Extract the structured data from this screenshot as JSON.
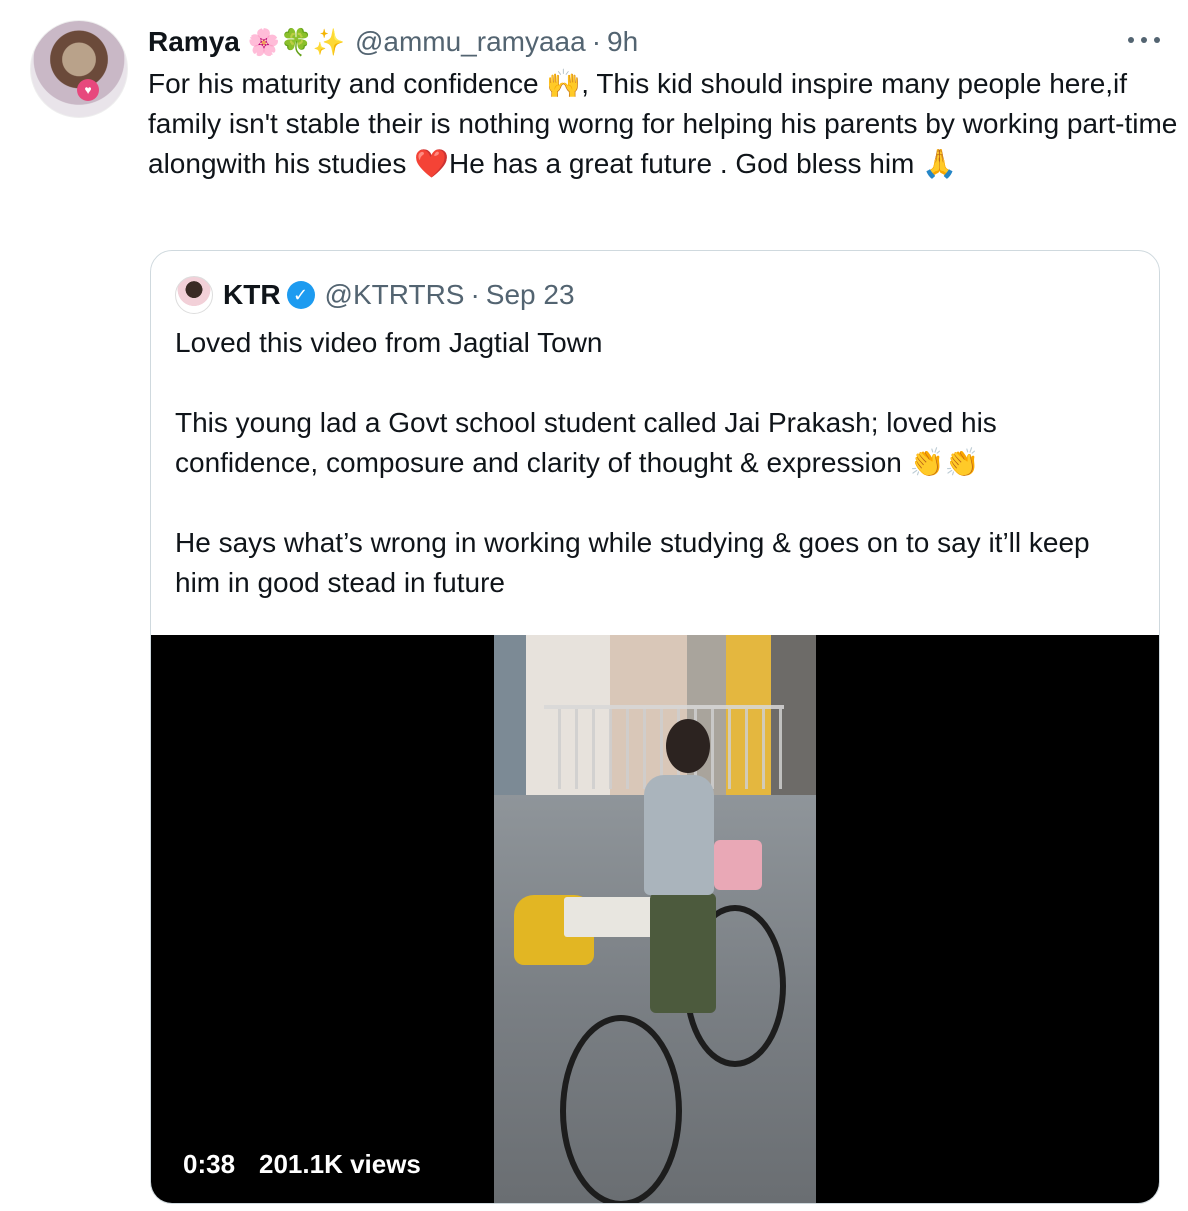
{
  "tweet": {
    "name": "Ramya",
    "name_emojis": "🌸🍀✨",
    "handle": "@ammu_ramyaaa",
    "separator": "·",
    "time": "9h",
    "text": "For his maturity and confidence 🙌, This kid should inspire many people here,if family isn't stable their is nothing worng for helping his parents by working part-time alongwith his studies ❤️He has a great future . God bless him 🙏",
    "more_icon": "more-horizontal-icon"
  },
  "quoted": {
    "name": "KTR",
    "verified_icon": "verified-badge-icon",
    "verified_glyph": "✓",
    "handle": "@KTRTRS",
    "separator": "·",
    "time": "Sep 23",
    "paragraphs": [
      "Loved this video from Jagtial Town",
      "This young lad a Govt school student called Jai Prakash; loved his confidence, composure and clarity of thought & expression 👏👏",
      "He says what’s wrong in working while studying & goes on to say it’ll keep him in good stead in future"
    ],
    "video": {
      "duration": "0:38",
      "views": "201.1K views"
    }
  },
  "colors": {
    "text": "#0f1419",
    "secondary": "#536471",
    "border": "#cfd9de",
    "verified": "#1d9bf0"
  }
}
